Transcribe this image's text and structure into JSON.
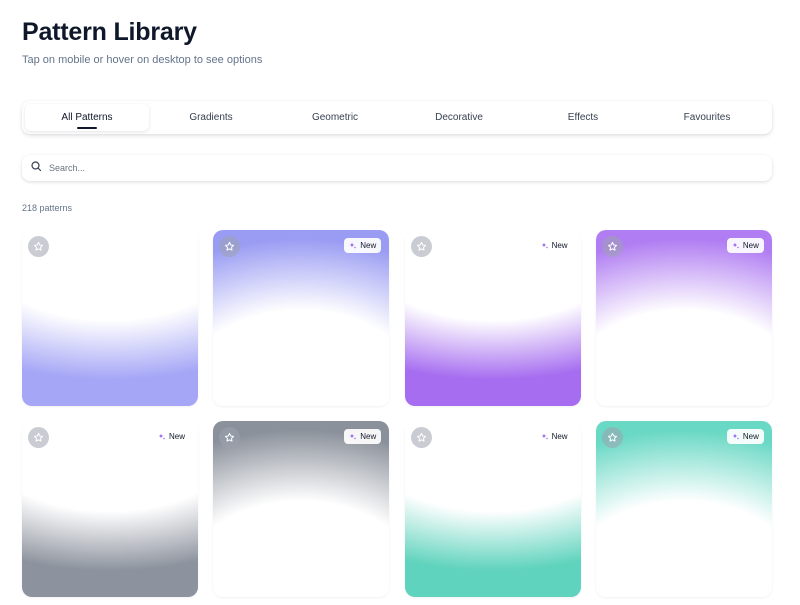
{
  "header": {
    "title": "Pattern Library",
    "subtitle": "Tap on mobile or hover on desktop to see options"
  },
  "tabs": [
    {
      "label": "All Patterns",
      "active": true
    },
    {
      "label": "Gradients",
      "active": false
    },
    {
      "label": "Geometric",
      "active": false
    },
    {
      "label": "Decorative",
      "active": false
    },
    {
      "label": "Effects",
      "active": false
    },
    {
      "label": "Favourites",
      "active": false
    }
  ],
  "search": {
    "placeholder": "Search...",
    "value": "",
    "icon": "search-icon"
  },
  "count_label": "218 patterns",
  "icons": {
    "favourite": "star-icon",
    "badge": "sparkle-icon"
  },
  "colors": {
    "indigo": "#a5a6f6",
    "purple": "#a66df0",
    "gray": "#8d939e",
    "teal": "#5fd3bd",
    "badge_icon": "#7c3aed"
  },
  "patterns": [
    {
      "gradient": "bottom-indigo",
      "new": false,
      "badge": ""
    },
    {
      "gradient": "top-indigo",
      "new": true,
      "badge": "New"
    },
    {
      "gradient": "bottom-purple",
      "new": true,
      "badge": "New"
    },
    {
      "gradient": "top-purple",
      "new": true,
      "badge": "New"
    },
    {
      "gradient": "bottom-gray",
      "new": true,
      "badge": "New"
    },
    {
      "gradient": "top-gray",
      "new": true,
      "badge": "New"
    },
    {
      "gradient": "bottom-teal",
      "new": true,
      "badge": "New"
    },
    {
      "gradient": "top-teal",
      "new": true,
      "badge": "New"
    }
  ]
}
